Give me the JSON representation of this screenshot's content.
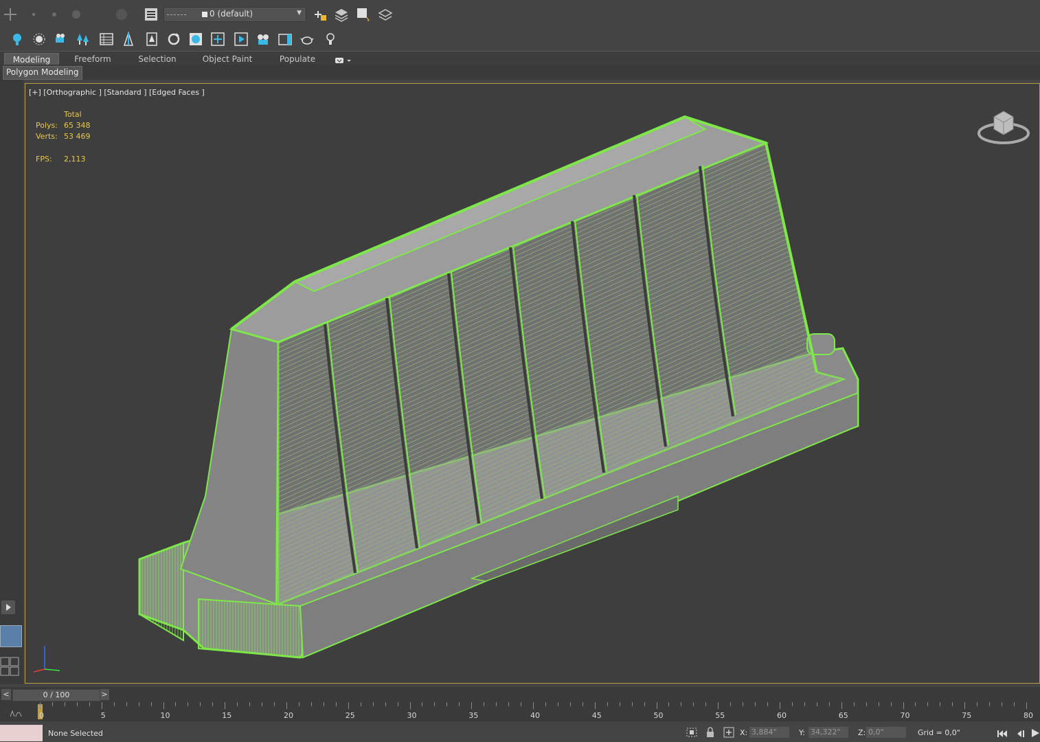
{
  "layer": {
    "name": "0 (default)"
  },
  "ribbon": {
    "tabs": [
      "Modeling",
      "Freeform",
      "Selection",
      "Object Paint",
      "Populate"
    ],
    "panel": "Polygon Modeling"
  },
  "viewport": {
    "label": "[+] [Orthographic ] [Standard ] [Edged Faces ]",
    "stats": {
      "total_header": "Total",
      "polys_label": "Polys:",
      "polys_value": "65 348",
      "verts_label": "Verts:",
      "verts_value": "53 469",
      "fps_label": "FPS:",
      "fps_value": "2,113"
    }
  },
  "timeline": {
    "frame_display": "0 / 100",
    "prev_label": "<",
    "next_label": ">",
    "ruler_labels": [
      "0",
      "5",
      "10",
      "15",
      "20",
      "25",
      "30",
      "35",
      "40",
      "45",
      "50",
      "55",
      "60",
      "65",
      "70",
      "75",
      "80"
    ]
  },
  "status": {
    "selection": "None Selected",
    "x_label": "X:",
    "x_value": "3,884\"",
    "y_label": "Y:",
    "y_value": "34,322\"",
    "z_label": "Z:",
    "z_value": "0,0\"",
    "grid": "Grid = 0,0\""
  },
  "colors": {
    "accent_green": "#7ee84a",
    "viewport_border": "#b8a04a",
    "stat_yellow": "#e8c84a"
  }
}
